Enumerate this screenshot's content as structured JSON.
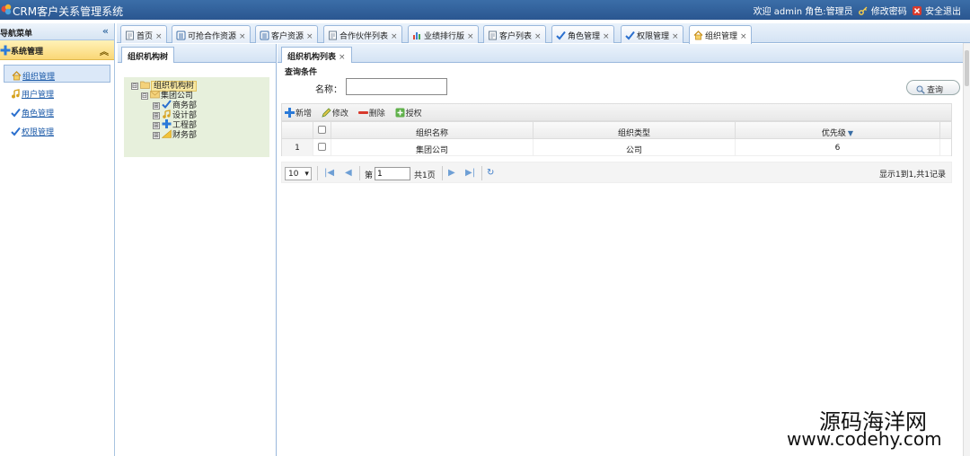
{
  "app": {
    "title": "CRM客户关系管理系统",
    "welcome": "欢迎 admin 角色:管理员",
    "change_password": "修改密码",
    "logout": "安全退出"
  },
  "nav": {
    "header": "导航菜单",
    "collapse_glyph": "«",
    "section": "系统管理",
    "section_toggle": "︽",
    "items": [
      {
        "label": "组织管理",
        "icon": "home-icon",
        "active": true
      },
      {
        "label": "用户管理",
        "icon": "music-note-icon"
      },
      {
        "label": "角色管理",
        "icon": "check-icon"
      },
      {
        "label": "权限管理",
        "icon": "check-icon"
      }
    ]
  },
  "tabs": [
    {
      "label": "首页",
      "icon": "page-icon"
    },
    {
      "label": "可抢合作资源",
      "icon": "list-icon"
    },
    {
      "label": "客户资源",
      "icon": "list-icon"
    },
    {
      "label": "合作伙伴列表",
      "icon": "page-icon"
    },
    {
      "label": "业绩排行版",
      "icon": "bar-chart-icon"
    },
    {
      "label": "客户列表",
      "icon": "page-icon"
    },
    {
      "label": "角色管理",
      "icon": "check-icon"
    },
    {
      "label": "权限管理",
      "icon": "check-icon"
    },
    {
      "label": "组织管理",
      "icon": "home-icon",
      "active": true
    }
  ],
  "tab_close": "×",
  "tree_panel": {
    "title": "组织机构树",
    "nodes": [
      {
        "label": "组织机构树",
        "level": 0,
        "toggle": "⊟",
        "icon": "folder-icon"
      },
      {
        "label": "集团公司",
        "level": 1,
        "toggle": "⊟",
        "icon": "mail-icon"
      },
      {
        "label": "商务部",
        "level": 2,
        "toggle": "⊞",
        "icon": "check-icon"
      },
      {
        "label": "设计部",
        "level": 2,
        "toggle": "⊞",
        "icon": "music-note-icon"
      },
      {
        "label": "工程部",
        "level": 2,
        "toggle": "⊞",
        "icon": "plus-icon"
      },
      {
        "label": "财务部",
        "level": 2,
        "toggle": "⊞",
        "icon": "chart-icon"
      }
    ]
  },
  "main_panel": {
    "title": "组织机构列表",
    "query_title": "查询条件",
    "name_label": "名称：",
    "name_value": "",
    "search_button": "查询",
    "toolbar": {
      "add": "新增",
      "edit": "修改",
      "delete": "删除",
      "grant": "授权"
    },
    "grid": {
      "columns": [
        "组织名称",
        "组织类型",
        "优先级"
      ],
      "sort_indicator": "▼",
      "rows": [
        {
          "index": "1",
          "name": "集团公司",
          "type": "公司",
          "priority": "6"
        }
      ]
    },
    "pager": {
      "page_size": "10",
      "page_size_caret": "▾",
      "first": "|◀",
      "prev": "◀",
      "page_prefix": "第",
      "page_value": "1",
      "page_total": "共1页",
      "next": "▶",
      "last": "▶|",
      "refresh": "↻",
      "info": "显示1到1,共1记录"
    }
  },
  "watermark": {
    "line1": "源码海洋网",
    "line2": "www.codehy.com"
  },
  "colors": {
    "topbar": "#2f5e9a",
    "nav_section": "#fad776",
    "tree_bg": "#e7f0dc",
    "link": "#1b5aa8"
  }
}
